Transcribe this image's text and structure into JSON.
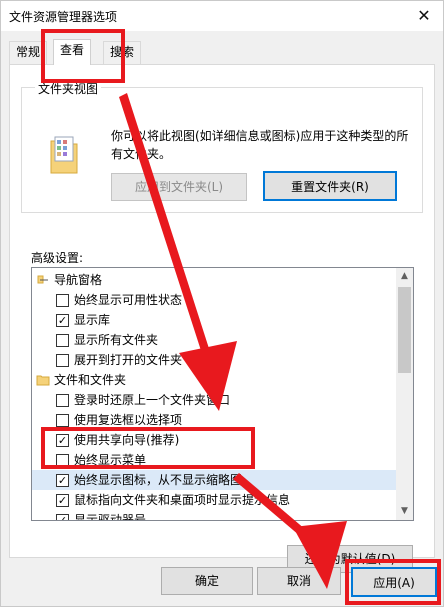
{
  "window": {
    "title": "文件资源管理器选项",
    "close_glyph": "✕"
  },
  "tabs": [
    {
      "label": "常规"
    },
    {
      "label": "查看"
    },
    {
      "label": "搜索"
    }
  ],
  "folder_views": {
    "title": "文件夹视图",
    "description": "你可以将此视图(如详细信息或图标)应用于这种类型的所有文件夹。",
    "apply_to_folders": "应用到文件夹(L)",
    "reset_folders": "重置文件夹(R)"
  },
  "advanced": {
    "label": "高级设置:",
    "tree": [
      {
        "type": "group",
        "icon": "navigation-pane-icon",
        "label": "导航窗格"
      },
      {
        "type": "check",
        "checked": false,
        "label": "始终显示可用性状态"
      },
      {
        "type": "check",
        "checked": true,
        "label": "显示库"
      },
      {
        "type": "check",
        "checked": false,
        "label": "显示所有文件夹"
      },
      {
        "type": "check",
        "checked": false,
        "label": "展开到打开的文件夹"
      },
      {
        "type": "group",
        "icon": "folder-icon",
        "label": "文件和文件夹"
      },
      {
        "type": "check",
        "checked": false,
        "label": "登录时还原上一个文件夹窗口"
      },
      {
        "type": "check",
        "checked": false,
        "label": "使用复选框以选择项"
      },
      {
        "type": "check",
        "checked": true,
        "label": "使用共享向导(推荐)"
      },
      {
        "type": "check",
        "checked": false,
        "label": "始终显示菜单"
      },
      {
        "type": "check",
        "checked": true,
        "label": "始终显示图标，从不显示缩略图",
        "highlighted": true
      },
      {
        "type": "check",
        "checked": true,
        "label": "鼠标指向文件夹和桌面项时显示提示信息"
      },
      {
        "type": "check",
        "checked": true,
        "label": "显示驱动器号"
      }
    ],
    "scroll_up": "▲",
    "scroll_down": "▼",
    "restore_defaults": "还原为默认值(D)"
  },
  "footer": {
    "ok": "确定",
    "cancel": "取消",
    "apply": "应用(A)"
  },
  "colors": {
    "annotation_red": "#e8191e",
    "focus_blue": "#0078d7",
    "highlight": "#dbe9f8"
  }
}
